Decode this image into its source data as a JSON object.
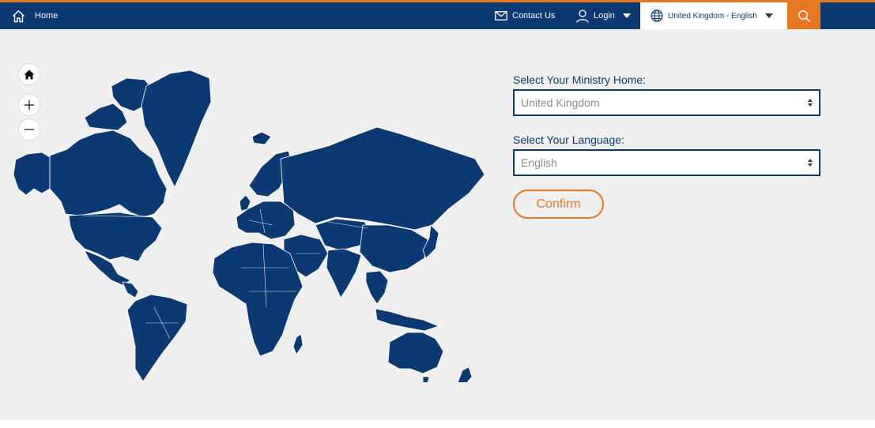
{
  "colors": {
    "navy": "#0b3a73",
    "orange": "#e87722",
    "background": "#efefef"
  },
  "nav": {
    "home_label": "Home",
    "home_icon": "home-icon",
    "contact_label": "Contact Us",
    "contact_icon": "envelope-icon",
    "login_label": "Login",
    "login_icon": "user-icon",
    "locale_label": "United Kingdom - English",
    "locale_icon": "globe-icon",
    "search_icon": "search-icon"
  },
  "map_controls": {
    "home_icon": "home-icon",
    "zoom_in_icon": "plus-icon",
    "zoom_out_icon": "minus-icon"
  },
  "form": {
    "ministry_label": "Select Your Ministry Home:",
    "ministry_value": "United Kingdom",
    "language_label": "Select Your Language:",
    "language_value": "English",
    "confirm_label": "Confirm"
  }
}
